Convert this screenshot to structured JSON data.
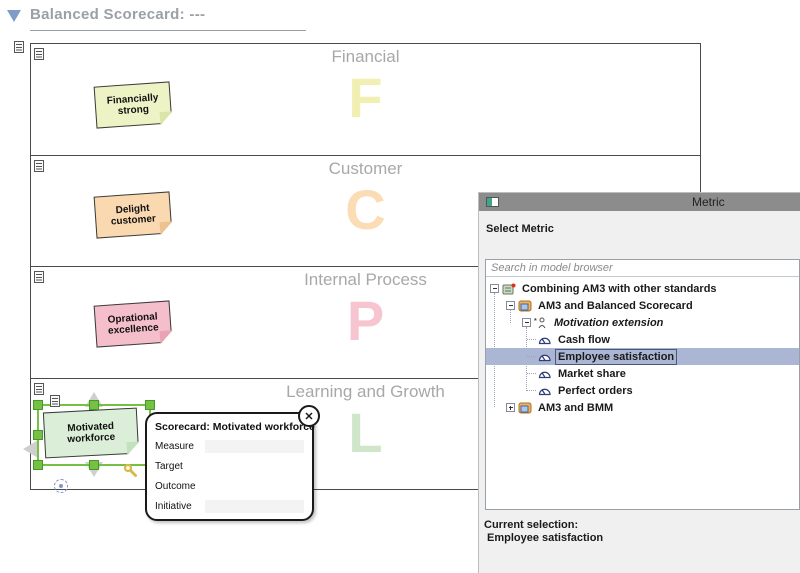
{
  "header": {
    "title": "Balanced Scorecard: ---"
  },
  "lanes": [
    {
      "title": "Financial",
      "letter": "F",
      "letter_color": "#f2efb2",
      "note": {
        "text": "Financially strong",
        "bg": "#eef3c6"
      }
    },
    {
      "title": "Customer",
      "letter": "C",
      "letter_color": "#fbdcb4",
      "note": {
        "text": "Delight customer",
        "bg": "#fad9b0"
      }
    },
    {
      "title": "Internal Process",
      "letter": "P",
      "letter_color": "#f7c5d0",
      "note": {
        "text": "Oprational excellence",
        "bg": "#f5becb"
      }
    },
    {
      "title": "Learning and Growth",
      "letter": "L",
      "letter_color": "#cfe6ca",
      "note": {
        "text": "Motivated workforce",
        "bg": "#dbeed8",
        "selected": true
      }
    }
  ],
  "popup": {
    "title": "Scorecard: Motivated workforce",
    "close_glyph": "✕",
    "fields": [
      {
        "label": "Measure",
        "value": ""
      },
      {
        "label": "Target",
        "value": ""
      },
      {
        "label": "Outcome",
        "value": ""
      },
      {
        "label": "Initiative",
        "value": ""
      }
    ]
  },
  "dialog": {
    "title": "Metric",
    "heading": "Select Metric",
    "search_placeholder": "Search in model browser",
    "tree": [
      {
        "label": "Combining AM3 with other standards",
        "level": 0,
        "expand": "minus",
        "icon": "model-icon",
        "style": "bold"
      },
      {
        "label": "AM3 and Balanced Scorecard",
        "level": 1,
        "expand": "minus",
        "icon": "diagram-icon",
        "style": "bold"
      },
      {
        "label": "Motivation extension",
        "level": 2,
        "expand": "minus",
        "icon": "profile-icon",
        "style": "italic"
      },
      {
        "label": "Cash flow",
        "level": 3,
        "expand": "none",
        "icon": "gauge-icon",
        "style": "bold"
      },
      {
        "label": "Employee satisfaction",
        "level": 3,
        "expand": "none",
        "icon": "gauge-icon",
        "style": "bold",
        "selected": true
      },
      {
        "label": "Market share",
        "level": 3,
        "expand": "none",
        "icon": "gauge-icon",
        "style": "bold"
      },
      {
        "label": "Perfect orders",
        "level": 3,
        "expand": "none",
        "icon": "gauge-icon",
        "style": "bold"
      },
      {
        "label": "AM3 and BMM",
        "level": 1,
        "expand": "plus",
        "icon": "diagram-icon",
        "style": "bold"
      }
    ],
    "current_selection_label": "Current selection:",
    "current_selection_value": "Employee satisfaction"
  },
  "colors": {
    "selection_green": "#76c043",
    "tree_selection_blue": "#aab6d3",
    "titlebar_gray": "#8c8c8c",
    "lane_title_gray": "#a8a8a8",
    "header_gray": "#9aa0a6",
    "header_triangle_blue": "#7e9cc7"
  }
}
